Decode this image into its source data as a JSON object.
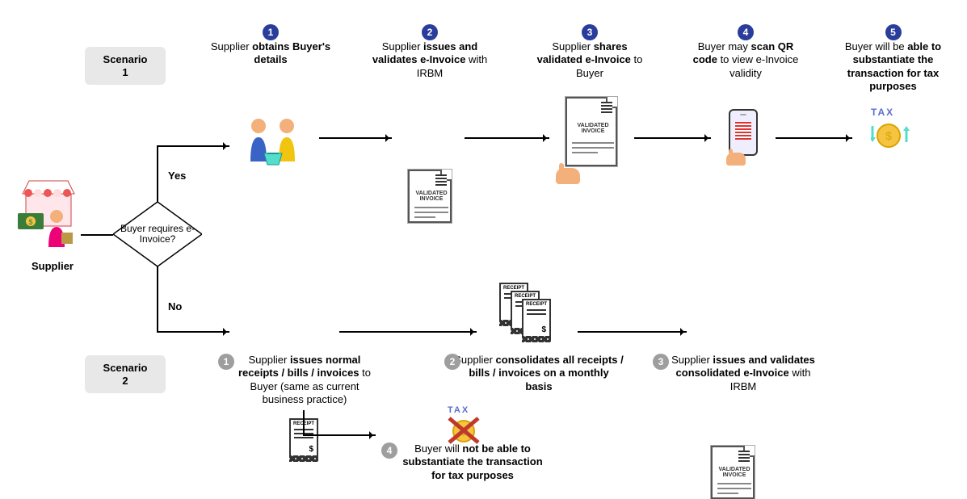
{
  "scenario1_label": "Scenario\n1",
  "scenario2_label": "Scenario\n2",
  "supplier_label": "Supplier",
  "decision_text": "Buyer requires e-Invoice?",
  "yes_label": "Yes",
  "no_label": "No",
  "s1": {
    "steps": [
      {
        "num": "1",
        "html": "Supplier <b>obtains Buyer's details</b>"
      },
      {
        "num": "2",
        "html": "Supplier <b>issues and validates e-Invoice</b> with IRBM"
      },
      {
        "num": "3",
        "html": "Supplier <b>shares validated e-Invoice</b> to Buyer"
      },
      {
        "num": "4",
        "html": "Buyer may <b>scan QR code</b> to view e-Invoice validity"
      },
      {
        "num": "5",
        "html": "Buyer will be <b>able to substantiate the transaction for tax purposes</b>"
      }
    ]
  },
  "s2": {
    "steps": [
      {
        "num": "1",
        "html": "Supplier <b>issues normal receipts / bills / invoices</b> to Buyer (same as current business practice)"
      },
      {
        "num": "2",
        "html": "Supplier <b>consolidates all receipts / bills / invoices on a monthly basis</b>"
      },
      {
        "num": "3",
        "html": "Supplier <b>issues and validates consolidated e-Invoice</b> with IRBM"
      },
      {
        "num": "4",
        "html": "Buyer will <b>not be able to substantiate the transaction for tax purposes</b>"
      }
    ]
  },
  "validated_invoice_text": "VALIDATED INVOICE",
  "receipt_text": "RECEIPT",
  "tax_text": "TAX"
}
